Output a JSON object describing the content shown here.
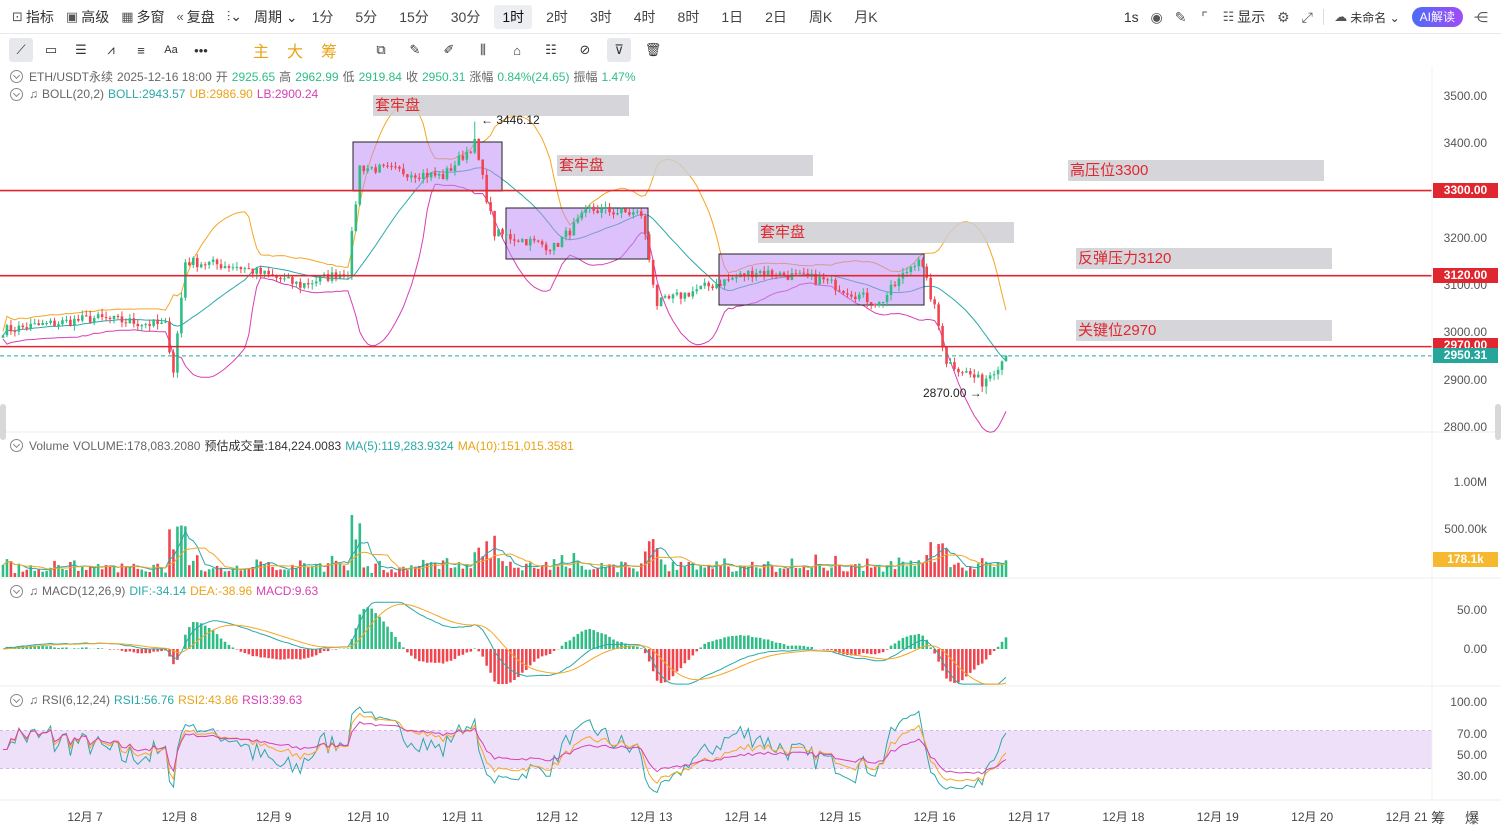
{
  "topbar": {
    "left": [
      {
        "icon": "chart-line-icon",
        "glyph": "⊡",
        "label": "指标"
      },
      {
        "icon": "advanced-icon",
        "glyph": "▣",
        "label": "高级"
      },
      {
        "icon": "multi-window-icon",
        "glyph": "▦",
        "label": "多窗"
      },
      {
        "icon": "replay-icon",
        "glyph": "«",
        "label": "复盘"
      }
    ],
    "chart_type_glyph": "⫶⌄",
    "period_label": "周期 ⌄",
    "timeframes": [
      "1分",
      "5分",
      "15分",
      "30分",
      "1时",
      "2时",
      "3时",
      "4时",
      "8时",
      "1日",
      "2日",
      "周K",
      "月K"
    ],
    "active_timeframe": "1时",
    "right": {
      "interval": "1s",
      "display_label": "显示",
      "account_label": "未命名 ⌄",
      "ai_label": "AI解读"
    }
  },
  "drawtools": {
    "tools": [
      "line-tool-icon",
      "rect-tool-icon",
      "lines-tool-icon",
      "wave-tool-icon",
      "fib-tool-icon",
      "text-tool-icon",
      "more-tool-icon"
    ],
    "glyphs": [
      "⟋",
      "▭",
      "☰",
      "⩘",
      "≡",
      "Aa",
      "•••"
    ],
    "cn_tools": [
      "主",
      "大",
      "筹"
    ],
    "tools2": [
      "copy-icon",
      "pen-icon",
      "brush-icon",
      "chart-icon",
      "clip-icon",
      "note-icon",
      "magnet-icon",
      "filter-icon",
      "trash-icon"
    ],
    "glyphs2": [
      "⧉",
      "✎",
      "✐",
      "⫼",
      "⌂",
      "☷",
      "⊘",
      "⊽",
      "🗑"
    ]
  },
  "info": {
    "symbol": "ETH/USDT永续",
    "datetime": "2025-12-16 18:00",
    "open_label": "开",
    "open": "2925.65",
    "high_label": "高",
    "high": "2962.99",
    "low_label": "低",
    "low": "2919.84",
    "close_label": "收",
    "close": "2950.31",
    "change_label": "涨幅",
    "change": "0.84%(24.65)",
    "amp_label": "振幅",
    "amp": "1.47%",
    "boll_name": "BOLL(20,2)",
    "boll": "BOLL:2943.57",
    "ub": "UB:2986.90",
    "lb": "LB:2900.24",
    "vol_name": "Volume",
    "vol": "VOLUME:178,083.2080",
    "est_vol": "预估成交量:184,224.0083",
    "vma5": "MA(5):119,283.9324",
    "vma10": "MA(10):151,015.3581",
    "macd_name": "MACD(12,26,9)",
    "dif": "DIF:-34.14",
    "dea": "DEA:-38.96",
    "macd": "MACD:9.63",
    "rsi_name": "RSI(6,12,24)",
    "rsi1": "RSI1:56.76",
    "rsi2": "RSI2:43.86",
    "rsi3": "RSI3:39.63"
  },
  "annotations": [
    {
      "text": "套牢盘"
    },
    {
      "text": "套牢盘"
    },
    {
      "text": "套牢盘"
    },
    {
      "text": "高压位3300"
    },
    {
      "text": "反弹压力3120"
    },
    {
      "text": "关键位2970"
    }
  ],
  "price_axis": [
    "3500.00",
    "3400.00",
    "3300.00",
    "3200.00",
    "3100.00",
    "3000.00",
    "2900.00",
    "2800.00"
  ],
  "price_tags": [
    {
      "text": "3300.00",
      "color": "#e0262f"
    },
    {
      "text": "3120.00",
      "color": "#e0262f"
    },
    {
      "text": "2970.00",
      "color": "#e0262f"
    },
    {
      "text": "2950.31",
      "color": "#26a69a"
    }
  ],
  "vol_axis": [
    "1.00M",
    "500.00k"
  ],
  "vol_tag": "178.1k",
  "macd_axis": [
    "50.00",
    "0.00"
  ],
  "rsi_axis": [
    "100.00",
    "70.00",
    "50.00",
    "30.00"
  ],
  "extremes": {
    "high": "← 3446.12",
    "low": "2870.00 →"
  },
  "dates": [
    "12月 7",
    "12月 8",
    "12月 9",
    "12月 10",
    "12月 11",
    "12月 12",
    "12月 13",
    "12月 14",
    "12月 15",
    "12月 16",
    "12月 17",
    "12月 18",
    "12月 19",
    "12月 20",
    "12月 21"
  ],
  "bottom_right": "筹 爆",
  "colors": {
    "up": "#2ebd85",
    "down": "#f0454f",
    "level": "#e0262f",
    "box": "#c08ef5",
    "band": "#e9d5f7"
  },
  "chart_data": {
    "type": "candlestick",
    "symbol": "ETH/USDT永续",
    "interval": "1h",
    "x_start": "2025-12-06 05:00",
    "x_end": "2025-12-16 18:00",
    "ylim": [
      2790,
      3540
    ],
    "levels": [
      3300,
      3120,
      2970
    ],
    "current_price": 2950.31,
    "key_closes": [
      {
        "t": "2025-12-06 05:00",
        "price": 3005
      },
      {
        "t": "2025-12-07 04:00",
        "price": 3030
      },
      {
        "t": "2025-12-07 22:00",
        "price": 3015
      },
      {
        "t": "2025-12-08 00:00",
        "price": 2920
      },
      {
        "t": "2025-12-08 03:00",
        "price": 3150
      },
      {
        "t": "2025-12-08 16:00",
        "price": 3140
      },
      {
        "t": "2025-12-09 08:00",
        "price": 3100
      },
      {
        "t": "2025-12-09 20:00",
        "price": 3130
      },
      {
        "t": "2025-12-09 23:00",
        "price": 3350
      },
      {
        "t": "2025-12-10 20:00",
        "price": 3330
      },
      {
        "t": "2025-12-11 04:00",
        "price": 3400
      },
      {
        "t": "2025-12-11 09:00",
        "price": 3210
      },
      {
        "t": "2025-12-12 00:00",
        "price": 3180
      },
      {
        "t": "2025-12-12 09:00",
        "price": 3260
      },
      {
        "t": "2025-12-12 22:00",
        "price": 3250
      },
      {
        "t": "2025-12-13 02:00",
        "price": 3060
      },
      {
        "t": "2025-12-13 12:00",
        "price": 3090
      },
      {
        "t": "2025-12-14 03:00",
        "price": 3130
      },
      {
        "t": "2025-12-14 20:00",
        "price": 3110
      },
      {
        "t": "2025-12-15 10:00",
        "price": 3060
      },
      {
        "t": "2025-12-15 20:00",
        "price": 3160
      },
      {
        "t": "2025-12-16 00:00",
        "price": 3050
      },
      {
        "t": "2025-12-16 03:00",
        "price": 2940
      },
      {
        "t": "2025-12-16 12:00",
        "price": 2895
      },
      {
        "t": "2025-12-16 18:00",
        "price": 2950
      }
    ],
    "extremes": {
      "high": 3446.12,
      "low": 2870.0
    },
    "rsi_band": [
      30,
      70
    ]
  }
}
